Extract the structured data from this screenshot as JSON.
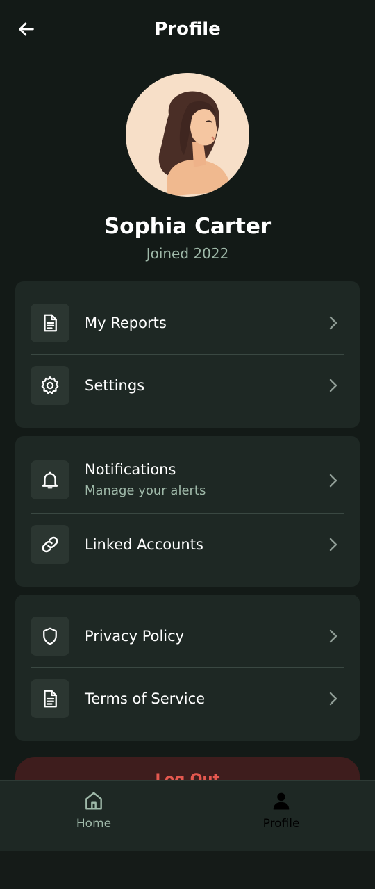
{
  "header": {
    "title": "Profile",
    "back_icon": "arrow-left-icon"
  },
  "profile": {
    "name": "Sophia Carter",
    "joined": "Joined 2022"
  },
  "groups": [
    {
      "items": [
        {
          "label": "My Reports",
          "sublabel": "",
          "icon": "document-icon"
        },
        {
          "label": "Settings",
          "sublabel": "",
          "icon": "gear-icon"
        }
      ]
    },
    {
      "items": [
        {
          "label": "Notifications",
          "sublabel": "Manage your alerts",
          "icon": "bell-icon"
        },
        {
          "label": "Linked Accounts",
          "sublabel": "",
          "icon": "link-icon"
        }
      ]
    },
    {
      "items": [
        {
          "label": "Privacy Policy",
          "sublabel": "",
          "icon": "shield-icon"
        },
        {
          "label": "Terms of Service",
          "sublabel": "",
          "icon": "document-icon"
        }
      ]
    }
  ],
  "logout": {
    "label": "Log Out"
  },
  "bottom_nav": {
    "items": [
      {
        "label": "Home",
        "icon": "home-icon",
        "active": false
      },
      {
        "label": "Profile",
        "icon": "person-icon",
        "active": true
      }
    ]
  },
  "colors": {
    "background": "#131a17",
    "card": "#1e2824",
    "icon_tile": "#2b3631",
    "muted_text": "#9fb9a9",
    "logout_bg": "#3e1d1d",
    "logout_text": "#e4584f"
  }
}
